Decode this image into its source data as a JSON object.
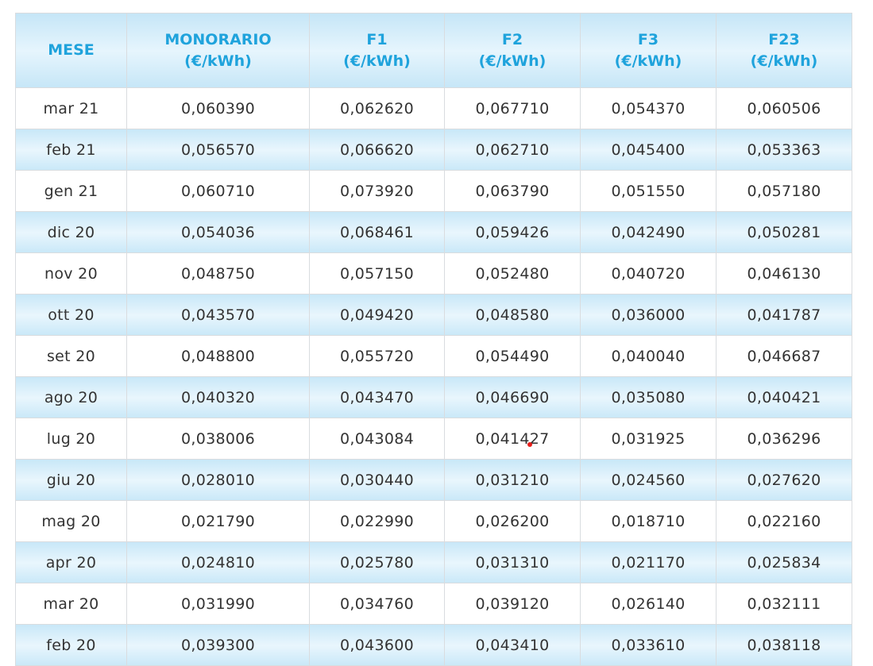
{
  "columns": [
    {
      "line1": "MESE",
      "line2": ""
    },
    {
      "line1": "MONORARIO",
      "line2": "(€/kWh)"
    },
    {
      "line1": "F1",
      "line2": "(€/kWh)"
    },
    {
      "line1": "F2",
      "line2": "(€/kWh)"
    },
    {
      "line1": "F3",
      "line2": "(€/kWh)"
    },
    {
      "line1": "F23",
      "line2": "(€/kWh)"
    }
  ],
  "rows": [
    [
      "mar 21",
      "0,060390",
      "0,062620",
      "0,067710",
      "0,054370",
      "0,060506"
    ],
    [
      "feb 21",
      "0,056570",
      "0,066620",
      "0,062710",
      "0,045400",
      "0,053363"
    ],
    [
      "gen 21",
      "0,060710",
      "0,073920",
      "0,063790",
      "0,051550",
      "0,057180"
    ],
    [
      "dic 20",
      "0,054036",
      "0,068461",
      "0,059426",
      "0,042490",
      "0,050281"
    ],
    [
      "nov 20",
      "0,048750",
      "0,057150",
      "0,052480",
      "0,040720",
      "0,046130"
    ],
    [
      "ott 20",
      "0,043570",
      "0,049420",
      "0,048580",
      "0,036000",
      "0,041787"
    ],
    [
      "set 20",
      "0,048800",
      "0,055720",
      "0,054490",
      "0,040040",
      "0,046687"
    ],
    [
      "ago 20",
      "0,040320",
      "0,043470",
      "0,046690",
      "0,035080",
      "0,040421"
    ],
    [
      "lug 20",
      "0,038006",
      "0,043084",
      "0,041427",
      "0,031925",
      "0,036296"
    ],
    [
      "giu 20",
      "0,028010",
      "0,030440",
      "0,031210",
      "0,024560",
      "0,027620"
    ],
    [
      "mag 20",
      "0,021790",
      "0,022990",
      "0,026200",
      "0,018710",
      "0,022160"
    ],
    [
      "apr 20",
      "0,024810",
      "0,025780",
      "0,031310",
      "0,021170",
      "0,025834"
    ],
    [
      "mar 20",
      "0,031990",
      "0,034760",
      "0,039120",
      "0,026140",
      "0,032111"
    ],
    [
      "feb 20",
      "0,039300",
      "0,043600",
      "0,043410",
      "0,033610",
      "0,038118"
    ]
  ],
  "colors": {
    "header_text": "#1fa3dc",
    "row_stripe": "#d6eefa",
    "border": "#d9dcdf",
    "cursor_dot": "#e8201c"
  }
}
